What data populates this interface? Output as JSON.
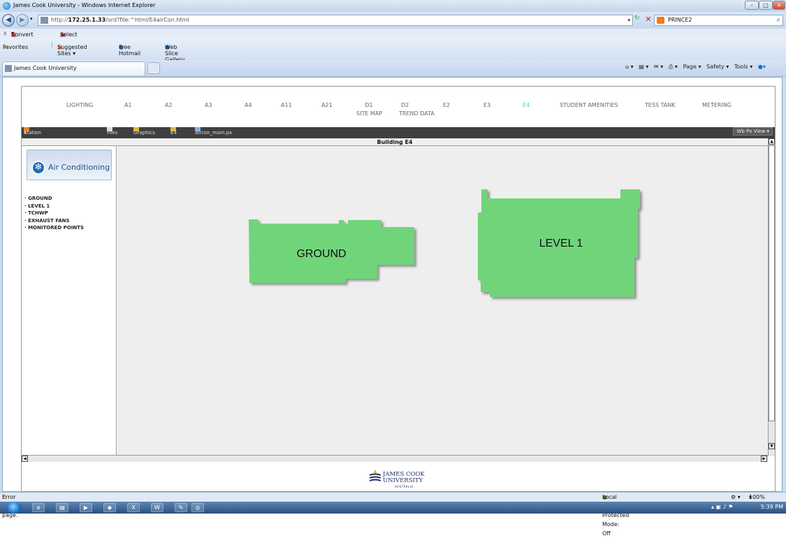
{
  "window": {
    "title": "James Cook University - Windows Internet Explorer",
    "controls": [
      "–",
      "□",
      "×"
    ]
  },
  "address": {
    "url_prefix": "http://",
    "url_host": "172.25.1.33",
    "url_path": "/ord?file:^html/E4airCon.html",
    "search_value": "PRINCE2"
  },
  "toolbar": {
    "close": "x",
    "convert": "Convert",
    "select": "Select"
  },
  "favorites": {
    "label": "Favorites",
    "items": [
      "Suggested Sites ▾",
      "Free Hotmail",
      "Web Slice Gallery ▾"
    ]
  },
  "tab": {
    "title": "James Cook University"
  },
  "commandbar": {
    "page": "Page ▾",
    "safety": "Safety ▾",
    "tools": "Tools ▾"
  },
  "page": {
    "nav": [
      {
        "label": "LIGHTING"
      },
      {
        "label": "A1"
      },
      {
        "label": "A2"
      },
      {
        "label": "A3"
      },
      {
        "label": "A4"
      },
      {
        "label": "A11"
      },
      {
        "label": "A21"
      },
      {
        "label": "D1",
        "sub": "SITE MAP"
      },
      {
        "label": "D2"
      },
      {
        "label": "E2"
      },
      {
        "label": "E3"
      },
      {
        "label": "E4",
        "active": true
      },
      {
        "label": "STUDENT AMENITIES"
      },
      {
        "label": "TESS TANK"
      },
      {
        "label": "METERING"
      }
    ],
    "nav_extra": "TREND DATA",
    "breadcrumb": [
      "Station (JCU_BMS_Server)",
      "Files",
      "Graphics",
      "E4",
      "aircon_main.px"
    ],
    "view_button": "Wb Px View ▾",
    "building_title": "Building E4",
    "panel_title": "Air Conditioning",
    "menu": [
      "· GROUND",
      "· LEVEL 1",
      "· TCHWP",
      "· EXHAUST FANS",
      "· MONITORED POINTS"
    ],
    "floor_ground": "GROUND",
    "floor_level1": "LEVEL 1",
    "floor_color": "#6fd57a",
    "logo_line1": "JAMES COOK",
    "logo_line2": "UNIVERSITY",
    "logo_line3": "AUSTRALIA"
  },
  "status": {
    "left": "Error on page.",
    "zone": "Local intranet | Protected Mode: Off",
    "zoom": "100%"
  },
  "taskbar": {
    "time": "5:39 PM"
  }
}
